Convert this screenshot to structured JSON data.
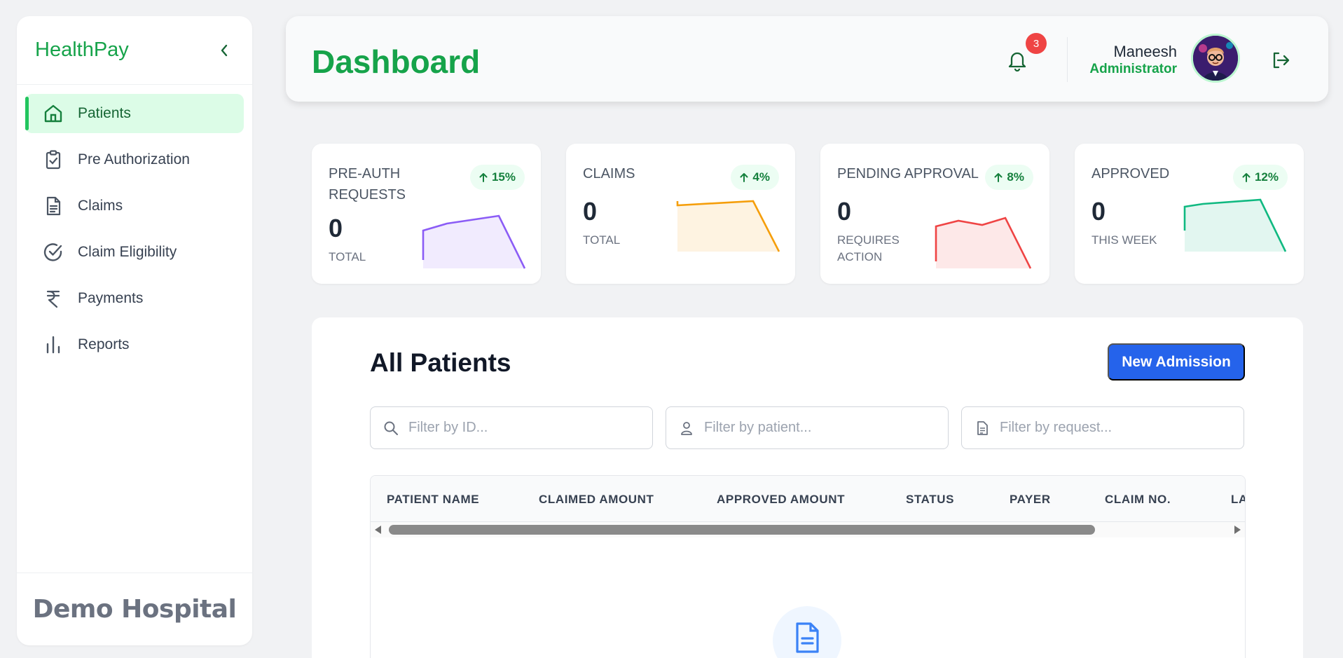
{
  "sidebar": {
    "brand": "HealthPay",
    "items": [
      {
        "label": "Patients",
        "icon": "home-icon",
        "active": true
      },
      {
        "label": "Pre Authorization",
        "icon": "clipboard-check-icon"
      },
      {
        "label": "Claims",
        "icon": "file-text-icon"
      },
      {
        "label": "Claim Eligibility",
        "icon": "check-circle-icon"
      },
      {
        "label": "Payments",
        "icon": "rupee-icon"
      },
      {
        "label": "Reports",
        "icon": "bar-chart-icon"
      }
    ],
    "footer": "Demo Hospital"
  },
  "header": {
    "title": "Dashboard",
    "notifications": "3",
    "user_name": "Maneesh",
    "user_role": "Administrator"
  },
  "stats": [
    {
      "title": "PRE-AUTH REQUESTS",
      "change": "15%",
      "value": "0",
      "sub": "TOTAL",
      "color": "#8b5cf6"
    },
    {
      "title": "CLAIMS",
      "change": "4%",
      "value": "0",
      "sub": "TOTAL",
      "color": "#f59e0b"
    },
    {
      "title": "PENDING APPROVAL",
      "change": "8%",
      "value": "0",
      "sub": "REQUIRES ACTION",
      "color": "#ef4444"
    },
    {
      "title": "APPROVED",
      "change": "12%",
      "value": "0",
      "sub": "THIS WEEK",
      "color": "#10b981"
    }
  ],
  "patients": {
    "title": "All Patients",
    "new_button": "New Admission",
    "filters": {
      "id_placeholder": "Filter by ID...",
      "patient_placeholder": "Filter by patient...",
      "request_placeholder": "Filter by request..."
    },
    "columns": [
      "PATIENT NAME",
      "CLAIMED AMOUNT",
      "APPROVED AMOUNT",
      "STATUS",
      "PAYER",
      "CLAIM NO.",
      "LA"
    ]
  },
  "colors": {
    "brand": "#16a34a",
    "primary_button": "#2563eb",
    "badge": "#ef4444"
  }
}
